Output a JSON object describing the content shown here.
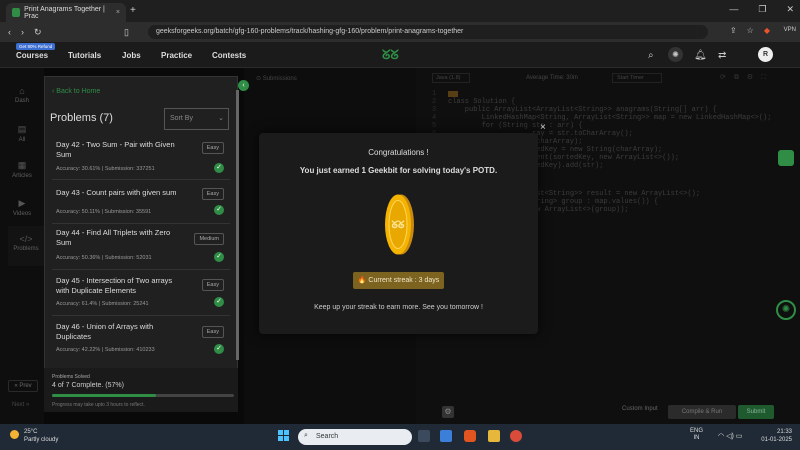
{
  "browser": {
    "tab_title": "Print Anagrams Together | Prac",
    "tab_close": "×",
    "new_tab": "+",
    "url": "geeksforgeeks.org/batch/gfg-160-problems/track/hashing-gfg-160/problem/print-anagrams-together",
    "vpn": "VPN"
  },
  "nav": {
    "refund_badge": "Get 90% Refund",
    "items": [
      "Courses",
      "Tutorials",
      "Jobs",
      "Practice",
      "Contests"
    ],
    "avatar": "R"
  },
  "rail": {
    "items": [
      "Dash",
      "All",
      "Articles",
      "Videos",
      "Problems"
    ],
    "prev": "« Prev",
    "next": "Next »"
  },
  "background": {
    "submissions_tab": "Submissions",
    "lang": "Java (1.8)",
    "avg_time": "Average Time: 30m",
    "start_timer": "Start Timer",
    "line_numbers": [
      "1",
      "2",
      "3",
      "4",
      "5",
      "6",
      "7",
      "8",
      "9",
      "10",
      "11"
    ],
    "code_lines": [
      "",
      "class Solution {",
      "    public ArrayList<ArrayList<String>> anagrams(String[] arr) {",
      "        LinkedHashMap<String, ArrayList<String>> map = new LinkedHashMap<>();",
      "        for (String str : arr) {",
      "                    ray = str.toCharArray();",
      "                    (charArray);",
      "                    tedKey = new String(charArray);",
      "                    sent(sortedKey, new ArrayList<>());",
      "                    tedKey).add(str);"
    ],
    "code_lines_2": [
      "                   List<String>> result = new ArrayList<>();",
      "                   String> group : map.values()) {",
      "                   new ArrayList<>(group));"
    ],
    "custom_input": "Custom Input",
    "compile_run": "Compile & Run",
    "submit": "Submit"
  },
  "panel": {
    "back": "Back to Home",
    "title": "Problems (7)",
    "sort_by": "Sort By",
    "problems": [
      {
        "title": "Day 42 - Two Sum - Pair with Given Sum",
        "difficulty": "Easy",
        "meta": "Accuracy: 30.61% | Submission: 337251"
      },
      {
        "title": "Day 43 - Count pairs with given sum",
        "difficulty": "Easy",
        "meta": "Accuracy: 50.11% | Submission: 35591"
      },
      {
        "title": "Day 44 - Find All Triplets with Zero Sum",
        "difficulty": "Medium",
        "meta": "Accuracy: 50.36% | Submission: 52031"
      },
      {
        "title": "Day 45 - Intersection of Two arrays with Duplicate Elements",
        "difficulty": "Easy",
        "meta": "Accuracy: 61.4% | Submission: 25241"
      },
      {
        "title": "Day 46 - Union of Arrays with Duplicates",
        "difficulty": "Easy",
        "meta": "Accuracy: 42.22% | Submission: 410233"
      }
    ],
    "solved_label": "Problems Solved",
    "solved_count": "4 of 7 Complete. (57%)",
    "solved_fraction": 0.57,
    "solved_note": "Progress may take upto 3 hours to reflect."
  },
  "modal": {
    "title": "Congratulations !",
    "message": "You just earned 1 Geekbit for solving today's POTD.",
    "streak": "🔥 Current streak : 3 days",
    "footer": "Keep up your streak to earn more. See you tomorrow !",
    "close": "×"
  },
  "taskbar": {
    "temp": "25°C",
    "weather": "Partly cloudy",
    "search": "Search",
    "lang_top": "ENG",
    "lang_bottom": "IN",
    "time": "21:33",
    "date": "01-01-2025"
  },
  "colors": {
    "brand": "#2f8d46",
    "streak": "#7d6320"
  }
}
